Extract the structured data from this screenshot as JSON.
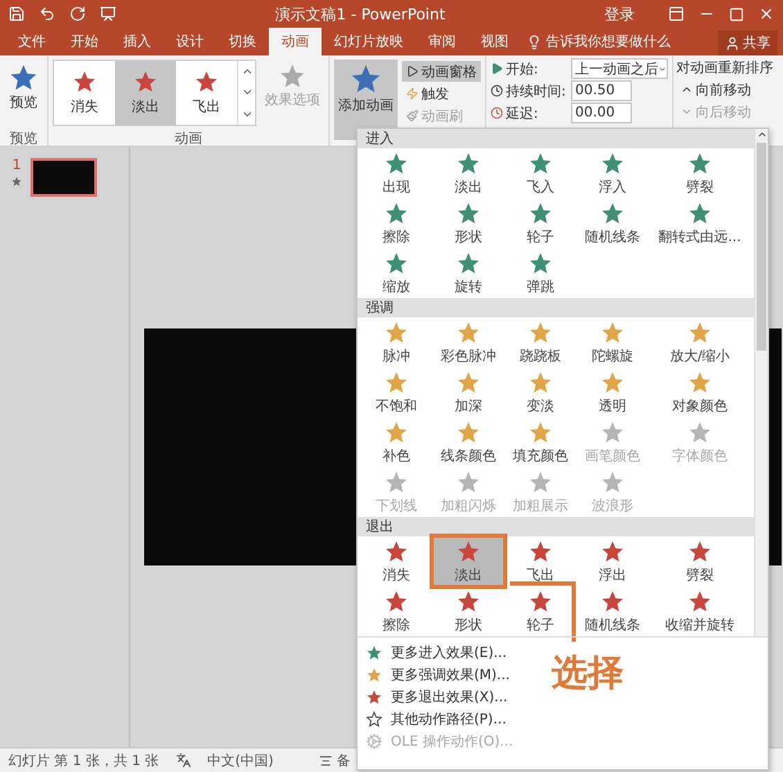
{
  "title_bar": {
    "title": "演示文稿1 - PowerPoint",
    "sign_in": "登录"
  },
  "tabs": [
    {
      "label": "文件",
      "selected": false
    },
    {
      "label": "开始",
      "selected": false
    },
    {
      "label": "插入",
      "selected": false
    },
    {
      "label": "设计",
      "selected": false
    },
    {
      "label": "切换",
      "selected": false
    },
    {
      "label": "动画",
      "selected": true
    },
    {
      "label": "幻灯片放映",
      "selected": false
    },
    {
      "label": "审阅",
      "selected": false
    },
    {
      "label": "视图",
      "selected": false
    }
  ],
  "tell_me": "告诉我你想要做什么",
  "share": "共享",
  "ribbon": {
    "preview": {
      "label": "预览",
      "group": "预览"
    },
    "gallery": {
      "group": "动画",
      "items": [
        {
          "label": "消失",
          "selected": false
        },
        {
          "label": "淡出",
          "selected": true
        },
        {
          "label": "飞出",
          "selected": false
        }
      ],
      "effect_options": {
        "label": "效果选项",
        "disabled": true
      }
    },
    "add_animation": {
      "label": "添加动画",
      "pressed": true
    },
    "small_buttons": [
      {
        "label": "动画窗格",
        "highlighted": true,
        "disabled": false
      },
      {
        "label": "触发",
        "highlighted": false,
        "disabled": false
      },
      {
        "label": "动画刷",
        "highlighted": false,
        "disabled": true
      }
    ],
    "timing": {
      "start_label": "开始:",
      "start_value": "上一动画之后",
      "duration_label": "持续时间:",
      "duration_value": "00.50",
      "delay_label": "延迟:",
      "delay_value": "00.00"
    },
    "reorder": {
      "title": "对动画重新排序",
      "buttons": [
        {
          "label": "向前移动",
          "disabled": false
        },
        {
          "label": "向后移动",
          "disabled": true
        }
      ]
    }
  },
  "slides": [
    {
      "number": "1",
      "selected": true,
      "has_animation": true
    }
  ],
  "effects_menu": {
    "sections": [
      {
        "title": "进入",
        "kind": "enter",
        "items": [
          {
            "label": "出现",
            "selected": false,
            "disabled": false
          },
          {
            "label": "淡出",
            "selected": false,
            "disabled": false
          },
          {
            "label": "飞入",
            "selected": false,
            "disabled": false
          },
          {
            "label": "浮入",
            "selected": false,
            "disabled": false
          },
          {
            "label": "劈裂",
            "selected": false,
            "disabled": false
          },
          {
            "label": "擦除",
            "selected": false,
            "disabled": false
          },
          {
            "label": "形状",
            "selected": false,
            "disabled": false
          },
          {
            "label": "轮子",
            "selected": false,
            "disabled": false
          },
          {
            "label": "随机线条",
            "selected": false,
            "disabled": false
          },
          {
            "label": "翻转式由远...",
            "selected": false,
            "disabled": false
          },
          {
            "label": "缩放",
            "selected": false,
            "disabled": false
          },
          {
            "label": "旋转",
            "selected": false,
            "disabled": false
          },
          {
            "label": "弹跳",
            "selected": false,
            "disabled": false
          }
        ]
      },
      {
        "title": "强调",
        "kind": "emphasis",
        "items": [
          {
            "label": "脉冲",
            "selected": false,
            "disabled": false
          },
          {
            "label": "彩色脉冲",
            "selected": false,
            "disabled": false
          },
          {
            "label": "跷跷板",
            "selected": false,
            "disabled": false
          },
          {
            "label": "陀螺旋",
            "selected": false,
            "disabled": false
          },
          {
            "label": "放大/缩小",
            "selected": false,
            "disabled": false
          },
          {
            "label": "不饱和",
            "selected": false,
            "disabled": false
          },
          {
            "label": "加深",
            "selected": false,
            "disabled": false
          },
          {
            "label": "变淡",
            "selected": false,
            "disabled": false
          },
          {
            "label": "透明",
            "selected": false,
            "disabled": false
          },
          {
            "label": "对象颜色",
            "selected": false,
            "disabled": false
          },
          {
            "label": "补色",
            "selected": false,
            "disabled": false
          },
          {
            "label": "线条颜色",
            "selected": false,
            "disabled": false
          },
          {
            "label": "填充颜色",
            "selected": false,
            "disabled": false
          },
          {
            "label": "画笔颜色",
            "selected": false,
            "disabled": true
          },
          {
            "label": "字体颜色",
            "selected": false,
            "disabled": true
          },
          {
            "label": "下划线",
            "selected": false,
            "disabled": true
          },
          {
            "label": "加粗闪烁",
            "selected": false,
            "disabled": true
          },
          {
            "label": "加粗展示",
            "selected": false,
            "disabled": true
          },
          {
            "label": "波浪形",
            "selected": false,
            "disabled": true
          }
        ]
      },
      {
        "title": "退出",
        "kind": "exit",
        "items": [
          {
            "label": "消失",
            "selected": false,
            "disabled": false
          },
          {
            "label": "淡出",
            "selected": true,
            "disabled": false
          },
          {
            "label": "飞出",
            "selected": false,
            "disabled": false
          },
          {
            "label": "浮出",
            "selected": false,
            "disabled": false
          },
          {
            "label": "劈裂",
            "selected": false,
            "disabled": false
          },
          {
            "label": "擦除",
            "selected": false,
            "disabled": false
          },
          {
            "label": "形状",
            "selected": false,
            "disabled": false
          },
          {
            "label": "轮子",
            "selected": false,
            "disabled": false
          },
          {
            "label": "随机线条",
            "selected": false,
            "disabled": false
          },
          {
            "label": "收缩并旋转",
            "selected": false,
            "disabled": false
          }
        ]
      }
    ],
    "more": [
      {
        "label": "更多进入效果(E)...",
        "kind": "enter",
        "disabled": false
      },
      {
        "label": "更多强调效果(M)...",
        "kind": "emphasis",
        "disabled": false
      },
      {
        "label": "更多退出效果(X)...",
        "kind": "exit",
        "disabled": false
      },
      {
        "label": "其他动作路径(P)...",
        "kind": "path",
        "disabled": false
      },
      {
        "label": "OLE 操作动作(O)...",
        "kind": "ole",
        "disabled": true
      }
    ]
  },
  "annotation": {
    "text": "选择"
  },
  "status_bar": {
    "slide_info": "幻灯片 第 1 张，共 1 张",
    "language": "中文(中国)",
    "notes": "备"
  }
}
